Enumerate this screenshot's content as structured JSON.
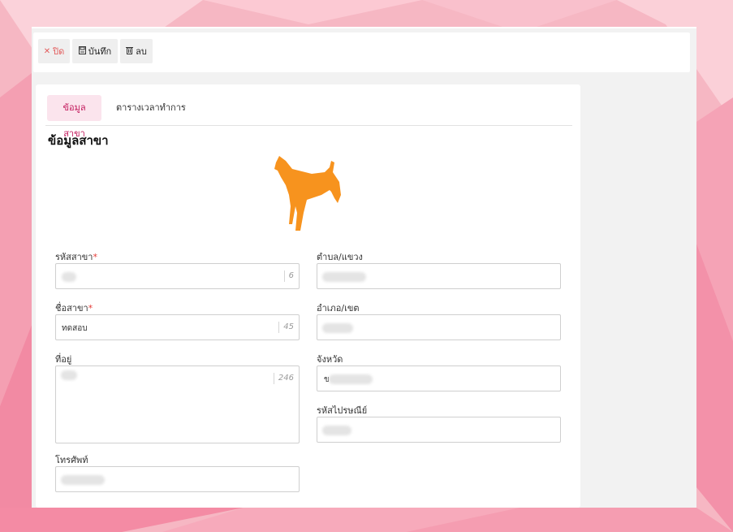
{
  "toolbar": {
    "close_label": "ปิด",
    "save_label": "บันทึก",
    "delete_label": "ลบ"
  },
  "tabs": [
    {
      "label": "ข้อมูลสาขา",
      "active": true
    },
    {
      "label": "ตารางเวลาทำการ",
      "active": false
    }
  ],
  "section_title": "ข้อมูลสาขา",
  "logo": {
    "icon": "dog-silhouette-icon",
    "color": "#f7931e"
  },
  "form": {
    "branch_code": {
      "label": "รหัสสาขา",
      "required": "*",
      "value": "",
      "char_count": "6"
    },
    "branch_name": {
      "label": "ชื่อสาขา",
      "required": "*",
      "value": "ทดสอบ",
      "char_count": "45"
    },
    "address": {
      "label": "ที่อยู่",
      "value": "",
      "char_count": "246"
    },
    "phone": {
      "label": "โทรศัพท์",
      "value": ""
    },
    "subdistrict": {
      "label": "ตำบล/แขวง",
      "value": ""
    },
    "district": {
      "label": "อำเภอ/เขต",
      "value": ""
    },
    "province": {
      "label": "จังหวัด",
      "value": "ข"
    },
    "postal_code": {
      "label": "รหัสไปรษณีย์",
      "value": ""
    }
  },
  "colors": {
    "accent_tab_bg": "#fbe4ed",
    "accent_tab_text": "#c2185b",
    "required": "#e53935",
    "close": "#e25b5b"
  }
}
